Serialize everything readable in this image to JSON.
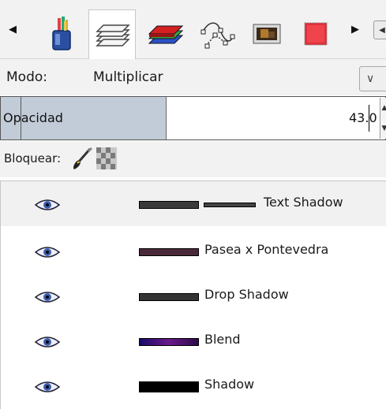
{
  "tabs": [
    {
      "name": "tool-options-icon"
    },
    {
      "name": "layers-icon",
      "active": true
    },
    {
      "name": "channels-icon"
    },
    {
      "name": "paths-icon"
    },
    {
      "name": "colormap-icon"
    },
    {
      "name": "histogram-icon"
    }
  ],
  "mode": {
    "label": "Modo:",
    "value": "Multiplicar"
  },
  "opacity": {
    "label": "Opacidad",
    "value": "43.0",
    "percent": 43.0
  },
  "lock": {
    "label": "Bloquear:"
  },
  "layers": [
    {
      "name": "Text Shadow",
      "visible": true,
      "selected": true,
      "thumb_color": "#2a2a2a"
    },
    {
      "name": "Pasea x Pontevedra",
      "visible": true,
      "selected": false,
      "thumb_color": "#5a2a3a"
    },
    {
      "name": "Drop Shadow",
      "visible": true,
      "selected": false,
      "thumb_color": "#2a2a2a"
    },
    {
      "name": "Blend",
      "visible": true,
      "selected": false,
      "thumb_color": "#2a0a5a"
    },
    {
      "name": "Shadow",
      "visible": true,
      "selected": false,
      "thumb_color": "#000000"
    }
  ],
  "colors": {
    "opacity_fill": "#c2ccd8",
    "selected_row": "#f1f1f1"
  }
}
